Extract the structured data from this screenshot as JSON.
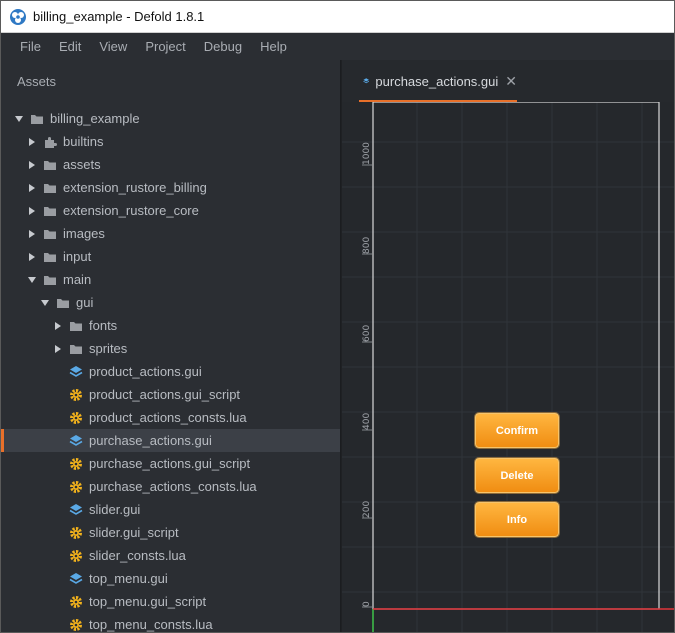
{
  "window": {
    "title": "billing_example - Defold 1.8.1"
  },
  "menu": [
    "File",
    "Edit",
    "View",
    "Project",
    "Debug",
    "Help"
  ],
  "assets": {
    "title": "Assets",
    "items": [
      {
        "label": "billing_example",
        "type": "folder",
        "expanded": true
      },
      {
        "label": "builtins",
        "type": "builtins",
        "expanded": false
      },
      {
        "label": "assets",
        "type": "folder",
        "expanded": false
      },
      {
        "label": "extension_rustore_billing",
        "type": "folder",
        "expanded": false
      },
      {
        "label": "extension_rustore_core",
        "type": "folder",
        "expanded": false
      },
      {
        "label": "images",
        "type": "folder",
        "expanded": false
      },
      {
        "label": "input",
        "type": "folder",
        "expanded": false
      },
      {
        "label": "main",
        "type": "folder",
        "expanded": true
      },
      {
        "label": "gui",
        "type": "folder",
        "expanded": true
      },
      {
        "label": "fonts",
        "type": "folder",
        "expanded": false
      },
      {
        "label": "sprites",
        "type": "folder",
        "expanded": false
      },
      {
        "label": "product_actions.gui",
        "type": "gui"
      },
      {
        "label": "product_actions.gui_script",
        "type": "script"
      },
      {
        "label": "product_actions_consts.lua",
        "type": "script"
      },
      {
        "label": "purchase_actions.gui",
        "type": "gui",
        "selected": true
      },
      {
        "label": "purchase_actions.gui_script",
        "type": "script"
      },
      {
        "label": "purchase_actions_consts.lua",
        "type": "script"
      },
      {
        "label": "slider.gui",
        "type": "gui"
      },
      {
        "label": "slider.gui_script",
        "type": "script"
      },
      {
        "label": "slider_consts.lua",
        "type": "script"
      },
      {
        "label": "top_menu.gui",
        "type": "gui"
      },
      {
        "label": "top_menu.gui_script",
        "type": "script"
      },
      {
        "label": "top_menu_consts.lua",
        "type": "script"
      }
    ]
  },
  "editor": {
    "tab": {
      "label": "purchase_actions.gui"
    },
    "ruler_labels": [
      "1000",
      "800",
      "600",
      "400",
      "200",
      "0"
    ],
    "buttons": [
      {
        "label": "Confirm"
      },
      {
        "label": "Delete"
      },
      {
        "label": "Info"
      }
    ]
  },
  "colors": {
    "accent": "#e8702a",
    "button": "#ffa52b",
    "folder": "#9a9da2",
    "gui_icon": "#5aa9e6",
    "script_icon": "#f2b21c"
  }
}
